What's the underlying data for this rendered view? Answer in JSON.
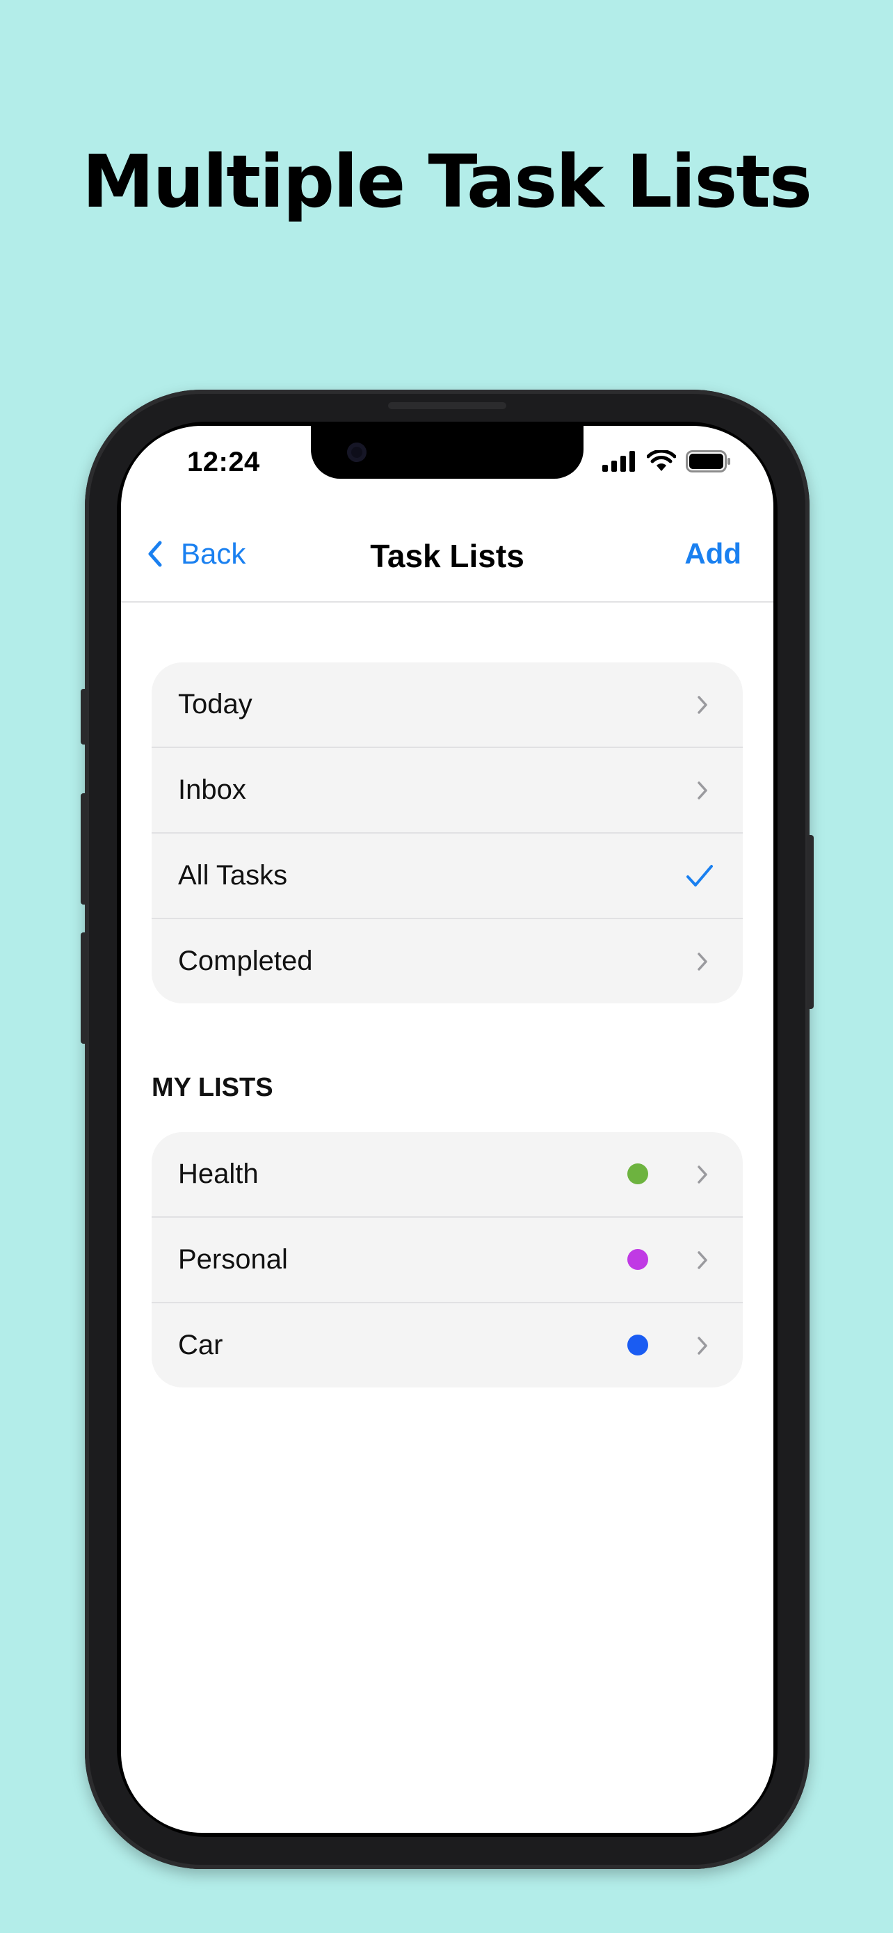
{
  "headline": "Multiple Task Lists",
  "status_bar": {
    "time": "12:24"
  },
  "nav": {
    "back_label": "Back",
    "title": "Task Lists",
    "add_label": "Add"
  },
  "smart_lists": [
    {
      "label": "Today",
      "accessory": "chevron"
    },
    {
      "label": "Inbox",
      "accessory": "chevron"
    },
    {
      "label": "All Tasks",
      "accessory": "checkmark"
    },
    {
      "label": "Completed",
      "accessory": "chevron"
    }
  ],
  "my_lists": {
    "header": "MY LISTS",
    "items": [
      {
        "label": "Health",
        "color": "#6db33f"
      },
      {
        "label": "Personal",
        "color": "#c03ae4"
      },
      {
        "label": "Car",
        "color": "#1a5cf2"
      }
    ]
  },
  "colors": {
    "accent": "#1a80f0",
    "background": "#b3ede9"
  }
}
